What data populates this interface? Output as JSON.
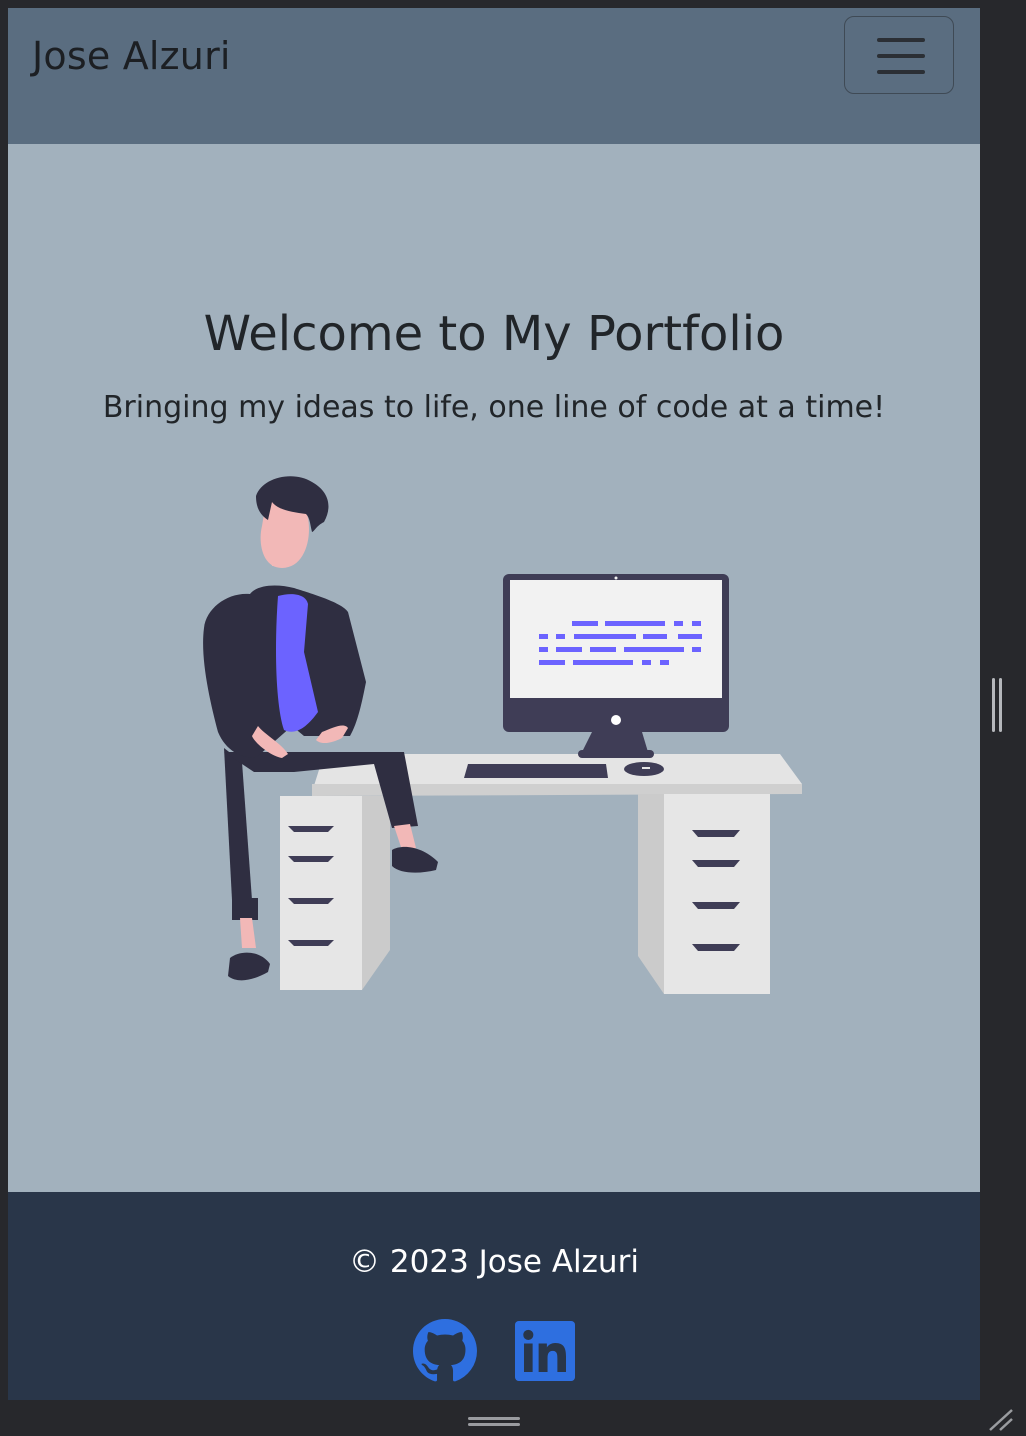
{
  "navbar": {
    "brand": "Jose Alzuri",
    "toggle_icon": "hamburger-menu-icon"
  },
  "hero": {
    "title": "Welcome to My Portfolio",
    "subtitle": "Bringing my ideas to life, one line of code at a time!",
    "illustration": "developer-sitting-on-desk-illustration"
  },
  "footer": {
    "copyright": "© 2023 Jose Alzuri",
    "links": [
      {
        "icon": "github-icon"
      },
      {
        "icon": "linkedin-icon"
      }
    ]
  },
  "colors": {
    "navbar_bg": "#5a6d80",
    "hero_bg": "#a2b1bd",
    "footer_bg": "#293649",
    "icon_blue": "#2e6fe0",
    "illustration_accent": "#6c63ff"
  }
}
